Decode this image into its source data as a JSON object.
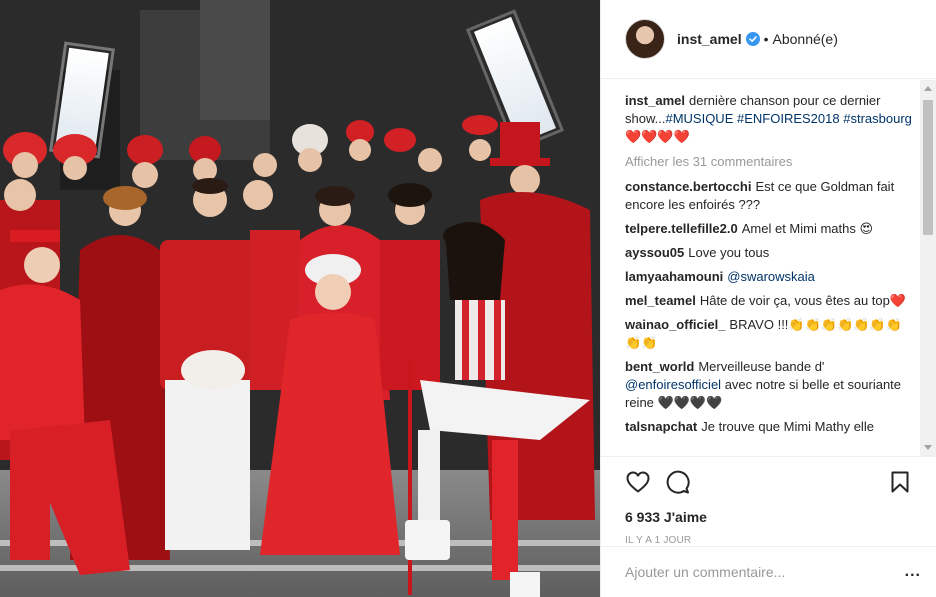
{
  "post": {
    "photo_alt": "",
    "username": "inst_amel",
    "follow_status": "Abonné(e)",
    "separator": "•"
  },
  "caption": {
    "username": "inst_amel",
    "text": "dernière chanson pour ce dernier show...",
    "tags": [
      "#MUSIQUE",
      "#ENFOIRES2018",
      "#strasbourg"
    ],
    "hearts": "❤️❤️❤️❤️"
  },
  "show_comments": "Afficher les 31 commentaires",
  "comments": [
    {
      "user": "constance.bertocchi",
      "text": "Est ce que Goldman fait encore les enfoirés ???",
      "mention": ""
    },
    {
      "user": "telpere.tellefille2.0",
      "text": "Amel et Mimi maths 😍",
      "mention": ""
    },
    {
      "user": "ayssou05",
      "text": "Love you tous",
      "mention": ""
    },
    {
      "user": "lamyaahamouni",
      "text": "",
      "mention": "@swarowskaia"
    },
    {
      "user": "mel_teamel",
      "text": "Hâte de voir ça, vous êtes au top❤️",
      "mention": ""
    },
    {
      "user": "wainao_officiel_",
      "text": "BRAVO !!!👏👏👏👏👏👏👏👏👏",
      "mention": ""
    },
    {
      "user": "bent_world",
      "text": "Merveilleuse bande d'",
      "mention": "@enfoiresofficiel",
      "text_after": "avec notre si belle et souriante reine 🖤🖤🖤🖤"
    },
    {
      "user": "talsnapchat",
      "text": "Je trouve que Mimi Mathy elle",
      "mention": ""
    }
  ],
  "actions": {
    "like_icon": "heart-outline",
    "comment_icon": "speech-bubble",
    "bookmark_icon": "bookmark"
  },
  "likes": "6 933 J'aime",
  "timestamp": "IL Y A 1 JOUR",
  "add_comment": {
    "placeholder": "Ajouter un commentaire...",
    "more": "..."
  },
  "colors": {
    "link": "#003569",
    "verified": "#3897f0",
    "muted": "#999999",
    "heart_red": "#ed4956"
  }
}
